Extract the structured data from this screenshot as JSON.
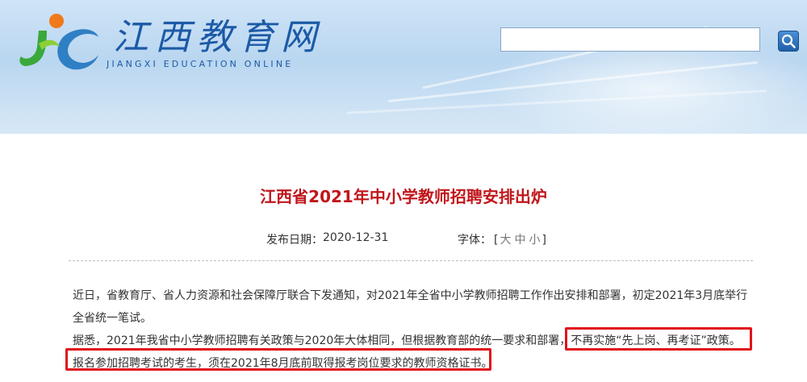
{
  "header": {
    "site_title": "江西教育网",
    "site_subtitle": "JIANGXI EDUCATION ONLINE",
    "search": {
      "value": "",
      "placeholder": ""
    },
    "logo_icon": "jc-logo-icon",
    "search_icon": "search-icon"
  },
  "article": {
    "title": "江西省2021年中小学教师招聘安排出炉",
    "date_label": "发布日期：",
    "date_value": "2020-12-31",
    "font_size_label": "字体：",
    "font_size_open": "[",
    "font_size_close": "]",
    "font_sizes": [
      "大",
      "中",
      "小"
    ],
    "paragraphs": {
      "p1_line1": "近日，省教育厅、省人力资源和社会保障厅联合下发通知，对2021年全省中小学教师招聘工作作出安排和部署，初定2021年3月底举行",
      "p1_line2": "全省统一笔试。",
      "p2_line1": "据悉，2021年我省中小学教师招聘有关政策与2020年大体相同，但根据教育部的统一要求和部署，不再实施“先上岗、再考证”政策。",
      "p2_line2": "报名参加招聘考试的考生，须在2021年8月底前取得报考岗位要求的教师资格证书。"
    }
  },
  "colors": {
    "title_red": "#c0161b",
    "highlight_red": "#e0121b",
    "brand_blue": "#1c5aa6"
  }
}
